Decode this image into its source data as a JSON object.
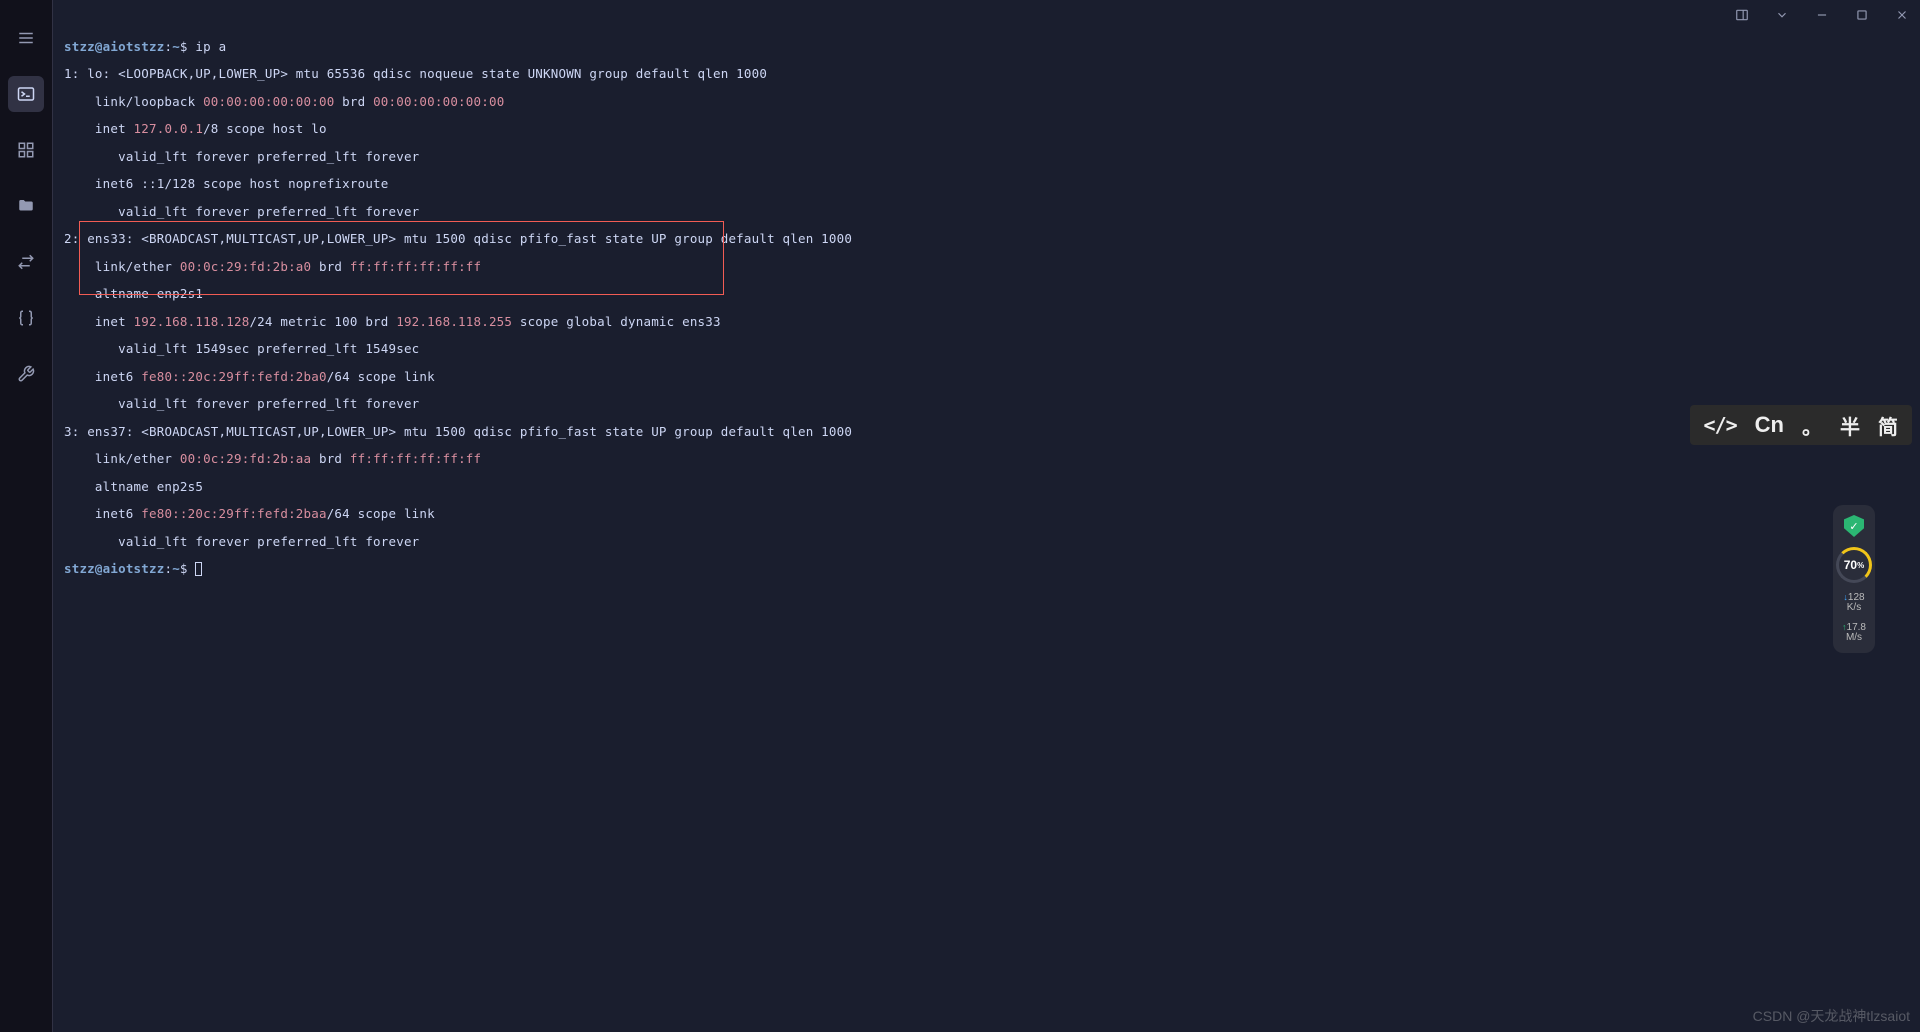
{
  "prompt": {
    "user": "stzz",
    "host": "aiotstzz",
    "path": "~",
    "symbol": "$"
  },
  "command": "ip a",
  "interfaces": [
    {
      "idx": "1",
      "name": "lo",
      "flags": "<LOOPBACK,UP,LOWER_UP>",
      "tail": "mtu 65536 qdisc noqueue state UNKNOWN group default qlen 1000",
      "link_type": "link/loopback",
      "mac1": "00:00:00:00:00:00",
      "brd_label": "brd",
      "mac2": "00:00:00:00:00:00",
      "inet_label": "inet",
      "inet_ip": "127.0.0.1",
      "inet_tail": "/8 scope host lo",
      "valid1": "valid_lft forever preferred_lft forever",
      "inet6_label": "inet6",
      "inet6_full": "::1/128 scope host noprefixroute",
      "valid2": "valid_lft forever preferred_lft forever"
    },
    {
      "idx": "2",
      "name": "ens33",
      "flags": "<BROADCAST,MULTICAST,UP,LOWER_UP>",
      "tail": "mtu 1500 qdisc pfifo_fast state UP group default qlen 1000",
      "link_type": "link/ether",
      "mac1": "00:0c:29:fd:2b:a0",
      "brd_label": "brd",
      "mac2": "ff:ff:ff:ff:ff:ff",
      "altname": "altname enp2s1",
      "inet_label": "inet",
      "inet_ip": "192.168.118.128",
      "inet_mid": "/24 metric 100 brd",
      "inet_brd": "192.168.118.255",
      "inet_tail": "scope global dynamic ens33",
      "valid1": "valid_lft 1549sec preferred_lft 1549sec",
      "inet6_label": "inet6",
      "inet6_ip": "fe80::20c:29ff:fefd:2ba0",
      "inet6_tail": "/64 scope link",
      "valid2": "valid_lft forever preferred_lft forever"
    },
    {
      "idx": "3",
      "name": "ens37",
      "flags": "<BROADCAST,MULTICAST,UP,LOWER_UP>",
      "tail": "mtu 1500 qdisc pfifo_fast state UP group default qlen 1000",
      "link_type": "link/ether",
      "mac1": "00:0c:29:fd:2b:aa",
      "brd_label": "brd",
      "mac2": "ff:ff:ff:ff:ff:ff",
      "altname": "altname enp2s5",
      "inet6_label": "inet6",
      "inet6_ip": "fe80::20c:29ff:fefd:2baa",
      "inet6_tail": "/64 scope link",
      "valid2": "valid_lft forever preferred_lft forever"
    }
  ],
  "ime": {
    "code": "</>",
    "lang": "Cn",
    "punc": "。",
    "half": "半",
    "simp": "简"
  },
  "widget": {
    "percent": "70",
    "unit": "%",
    "down_val": "128",
    "down_unit": "K/s",
    "up_val": "17.8",
    "up_unit": "M/s"
  },
  "watermark": "CSDN @天龙战神tlzsaiot"
}
